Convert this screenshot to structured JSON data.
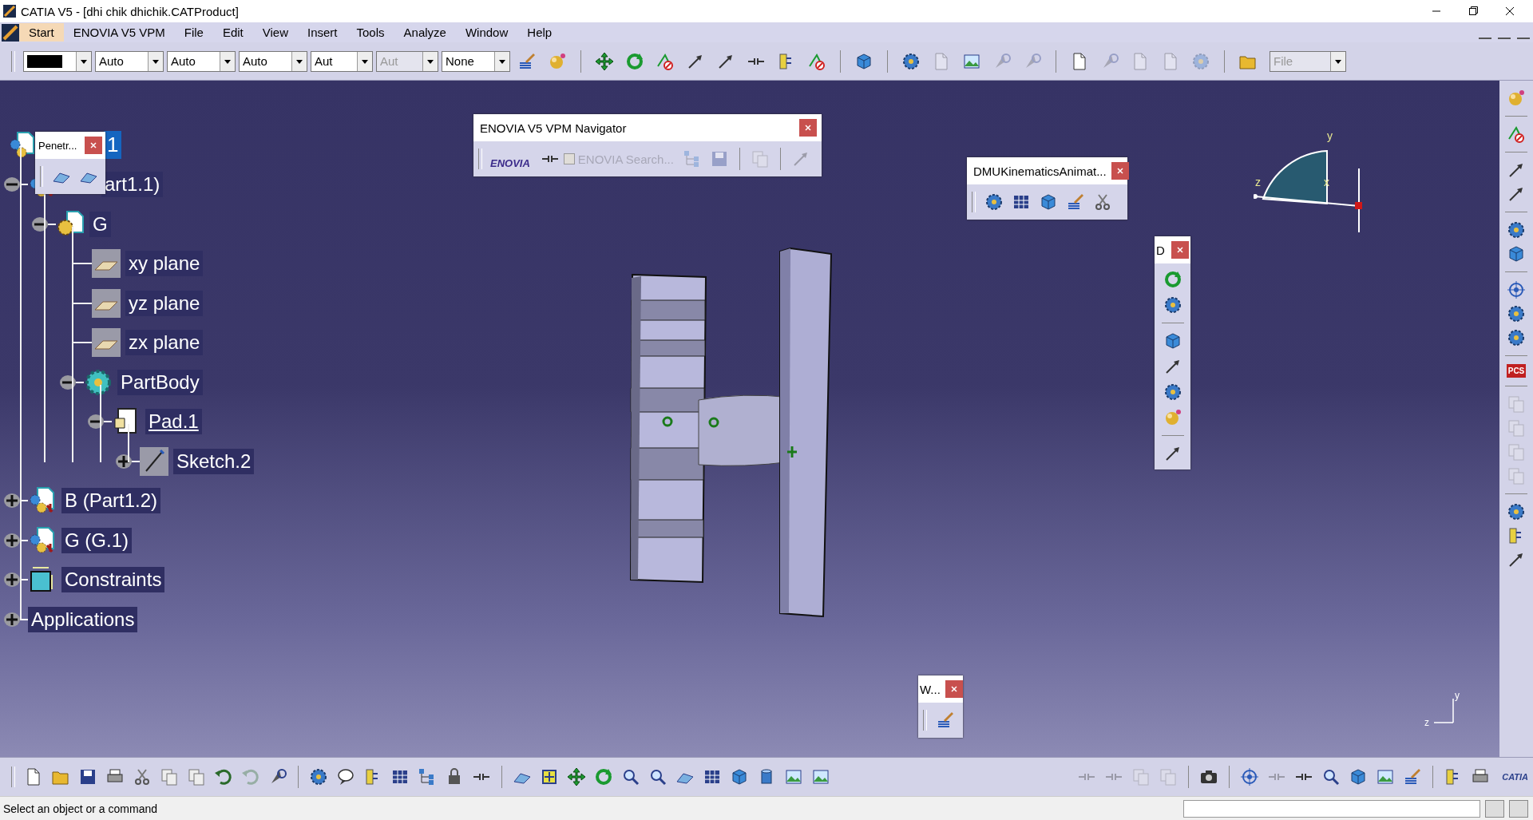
{
  "window": {
    "title": "CATIA V5 - [dhi chik dhichik.CATProduct]"
  },
  "menu": [
    {
      "label": "Start",
      "selected": true
    },
    {
      "label": "ENOVIA V5 VPM",
      "selected": false
    },
    {
      "label": "File",
      "selected": false
    },
    {
      "label": "Edit",
      "selected": false
    },
    {
      "label": "View",
      "selected": false
    },
    {
      "label": "Insert",
      "selected": false
    },
    {
      "label": "Tools",
      "selected": false
    },
    {
      "label": "Analyze",
      "selected": false
    },
    {
      "label": "Window",
      "selected": false
    },
    {
      "label": "Help",
      "selected": false
    }
  ],
  "toolbar": {
    "combos": [
      {
        "kind": "color",
        "color": "#000000",
        "disabled": false
      },
      {
        "kind": "text",
        "value": "Auto",
        "disabled": false
      },
      {
        "kind": "text",
        "value": "Auto",
        "disabled": false
      },
      {
        "kind": "text",
        "value": "Auto",
        "disabled": false
      },
      {
        "kind": "text",
        "value": "Aut",
        "disabled": false
      },
      {
        "kind": "text",
        "value": "Aut",
        "disabled": true
      },
      {
        "kind": "text",
        "value": "None",
        "disabled": false
      }
    ],
    "file_combo": {
      "value": "File",
      "disabled": true
    }
  },
  "tree": {
    "root": {
      "label": "1",
      "kind": "product",
      "selected": true,
      "current": false,
      "children": [
        {
          "label": "art1.1)",
          "kind": "part",
          "selected": false,
          "current": false,
          "expanded": true,
          "children": [
            {
              "label": "G",
              "kind": "body-part",
              "selected": false,
              "current": false,
              "expanded": true,
              "children": [
                {
                  "label": "xy plane",
                  "kind": "plane",
                  "selected": false,
                  "current": false
                },
                {
                  "label": "yz plane",
                  "kind": "plane",
                  "selected": false,
                  "current": false
                },
                {
                  "label": "zx plane",
                  "kind": "plane",
                  "selected": false,
                  "current": false
                },
                {
                  "label": "PartBody",
                  "kind": "body",
                  "selected": false,
                  "current": false,
                  "expanded": true,
                  "children": [
                    {
                      "label": "Pad.1",
                      "kind": "pad",
                      "selected": false,
                      "current": true,
                      "expanded": true,
                      "children": [
                        {
                          "label": "Sketch.2",
                          "kind": "sketch",
                          "selected": false,
                          "current": false,
                          "expanded": false
                        }
                      ]
                    }
                  ]
                }
              ]
            }
          ]
        },
        {
          "label": "B (Part1.2)",
          "kind": "part",
          "selected": false,
          "current": false,
          "expanded": false
        },
        {
          "label": "G (G.1)",
          "kind": "part",
          "selected": false,
          "current": false,
          "expanded": false
        },
        {
          "label": "Constraints",
          "kind": "constraints",
          "selected": false,
          "current": false,
          "expanded": false
        },
        {
          "label": "Applications",
          "kind": "none",
          "selected": false,
          "current": false,
          "expanded": false
        }
      ]
    }
  },
  "floating_toolbars": {
    "penetration": {
      "title": "Penetr..."
    },
    "enovia": {
      "title": "ENOVIA V5 VPM Navigator",
      "logo": "ENOVIA",
      "search": {
        "label": "ENOVIA Search...",
        "checked": false,
        "disabled": true
      }
    },
    "dmu": {
      "title": "DMUKinematicsAnimat..."
    },
    "d": {
      "title": "D"
    },
    "w": {
      "title": "W..."
    }
  },
  "compass": {
    "labels": [
      "y",
      "z",
      "x"
    ]
  },
  "axis_triad": {
    "labels": [
      "y",
      "z"
    ]
  },
  "right_toolbar": {
    "badge": "PCS"
  },
  "bottom_toolbar": {
    "logo": "CATIA"
  },
  "status_bar": {
    "message": "Select an object or a command"
  }
}
